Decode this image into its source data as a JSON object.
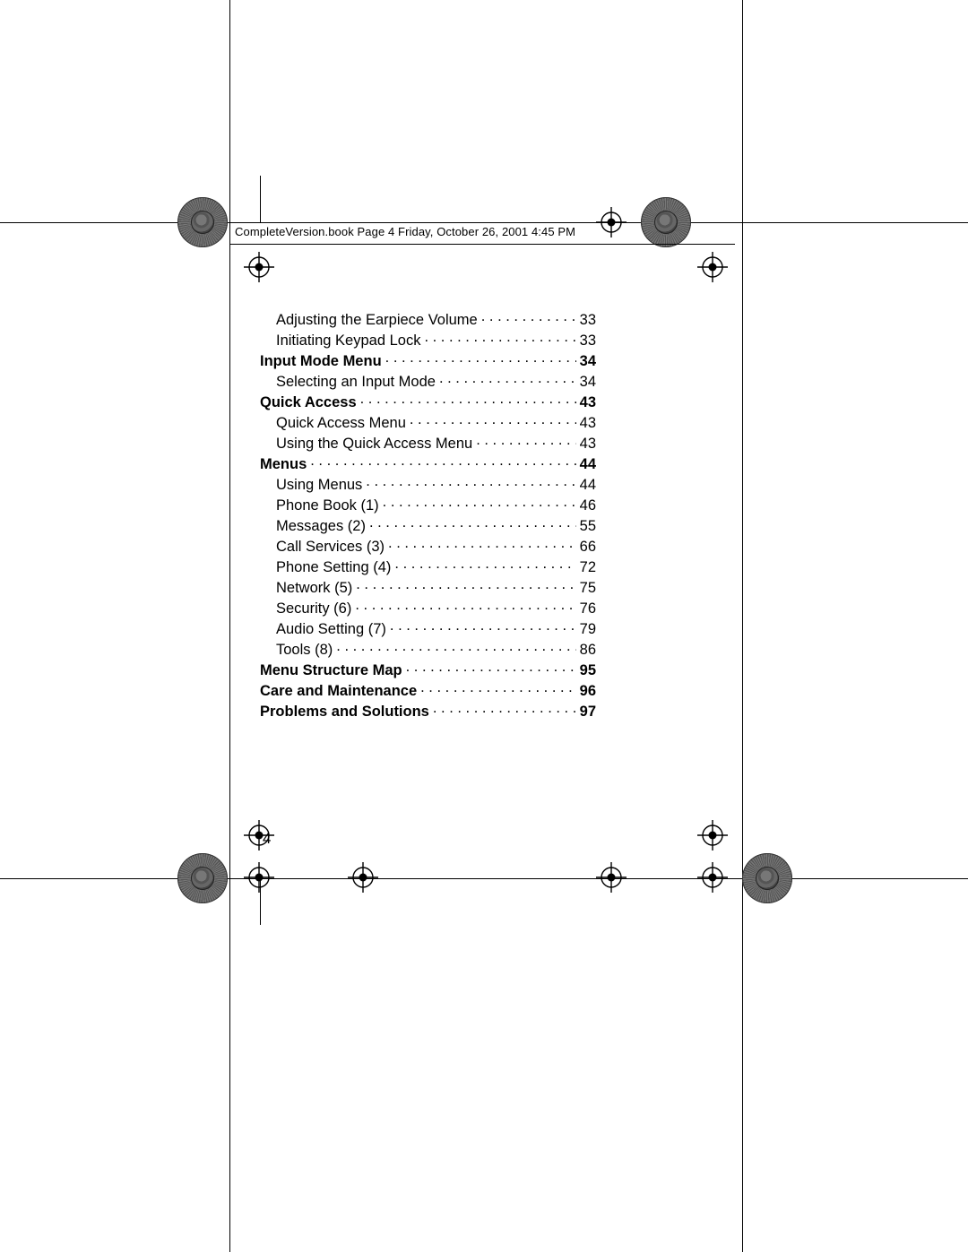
{
  "header": "CompleteVersion.book  Page 4  Friday, October 26, 2001  4:45 PM",
  "page_number": "4",
  "toc": [
    {
      "label": "Adjusting the Earpiece Volume",
      "page": "33",
      "bold": false,
      "indent": 1
    },
    {
      "label": "Initiating Keypad Lock",
      "page": "33",
      "bold": false,
      "indent": 1
    },
    {
      "label": "Input Mode Menu",
      "page": "34",
      "bold": true,
      "indent": 0
    },
    {
      "label": "Selecting an Input Mode",
      "page": "34",
      "bold": false,
      "indent": 1
    },
    {
      "label": "Quick Access",
      "page": "43",
      "bold": true,
      "indent": 0
    },
    {
      "label": "Quick Access Menu",
      "page": "43",
      "bold": false,
      "indent": 1
    },
    {
      "label": "Using the Quick Access Menu",
      "page": "43",
      "bold": false,
      "indent": 1
    },
    {
      "label": "Menus",
      "page": "44",
      "bold": true,
      "indent": 0
    },
    {
      "label": "Using Menus",
      "page": "44",
      "bold": false,
      "indent": 1
    },
    {
      "label": "Phone Book (1)",
      "page": "46",
      "bold": false,
      "indent": 1
    },
    {
      "label": "Messages (2)",
      "page": "55",
      "bold": false,
      "indent": 1
    },
    {
      "label": "Call Services (3)",
      "page": "66",
      "bold": false,
      "indent": 1
    },
    {
      "label": "Phone Setting (4)",
      "page": "72",
      "bold": false,
      "indent": 1
    },
    {
      "label": "Network (5)",
      "page": "75",
      "bold": false,
      "indent": 1
    },
    {
      "label": "Security (6)",
      "page": "76",
      "bold": false,
      "indent": 1
    },
    {
      "label": "Audio Setting (7)",
      "page": "79",
      "bold": false,
      "indent": 1
    },
    {
      "label": "Tools (8)",
      "page": "86",
      "bold": false,
      "indent": 1
    },
    {
      "label": "Menu Structure Map",
      "page": "95",
      "bold": true,
      "indent": 0
    },
    {
      "label": "Care and Maintenance",
      "page": "96",
      "bold": true,
      "indent": 0
    },
    {
      "label": "Problems and Solutions",
      "page": "97",
      "bold": true,
      "indent": 0
    }
  ]
}
